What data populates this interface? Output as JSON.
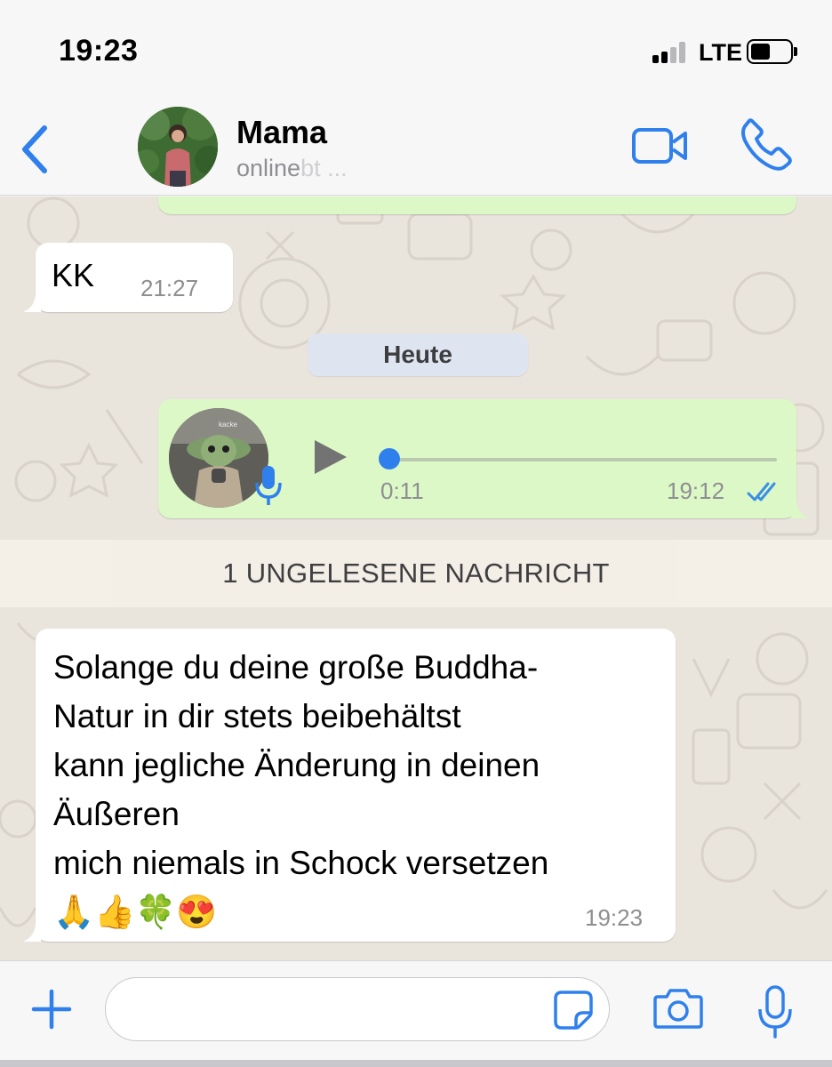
{
  "status_bar": {
    "time": "19:23",
    "network": "LTE"
  },
  "header": {
    "contact_name": "Mama",
    "contact_status": "online",
    "contact_status_faded": "bt ..."
  },
  "messages": {
    "kk": {
      "text": "KK",
      "time": "21:27"
    },
    "day_separator": "Heute",
    "voice": {
      "duration": "0:11",
      "time": "19:12",
      "avatar_caption": "kacke"
    },
    "unread_banner": "1 UNGELESENE NACHRICHT",
    "text_message": {
      "lines": [
        "Solange du deine große Buddha-",
        "Natur in dir stets beibehältst",
        "kann jegliche Änderung in deinen",
        "Äußeren",
        "mich niemals in Schock versetzen",
        "🙏👍🍀😍"
      ],
      "time": "19:23"
    }
  },
  "input": {
    "value": "",
    "placeholder": ""
  },
  "colors": {
    "accent": "#2f80ed",
    "outgoing_bubble": "#dcf8c6",
    "incoming_bubble": "#ffffff",
    "chat_background": "#e9e4dc"
  },
  "icons": {
    "back": "chevron-left-icon",
    "video": "video-camera-icon",
    "call": "phone-icon",
    "play": "play-icon",
    "mic": "microphone-icon",
    "read": "double-check-icon",
    "plus": "plus-icon",
    "sticker": "sticker-icon",
    "camera": "camera-icon"
  }
}
